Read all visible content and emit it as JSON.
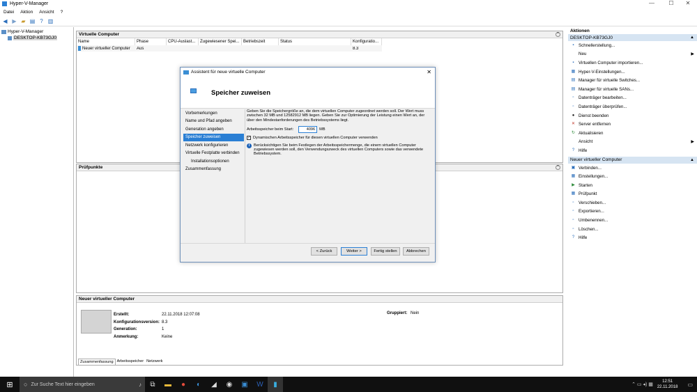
{
  "window": {
    "title": "Hyper-V-Manager",
    "minimize": "—",
    "maximize": "☐",
    "close": "✕"
  },
  "menu": [
    "Datei",
    "Aktion",
    "Ansicht",
    "?"
  ],
  "tree": {
    "root": "Hyper-V-Manager",
    "host": "DESKTOP-KB73GJ0"
  },
  "vms": {
    "title": "Virtuelle Computer",
    "columns": [
      "Name",
      "Phase",
      "CPU-Auslast...",
      "Zugewiesener Spei...",
      "Betriebszeit",
      "Status",
      "Konfiguratio..."
    ],
    "rows": [
      {
        "name": "Neuer virtueller Computer",
        "phase": "Aus",
        "cpu": "",
        "mem": "",
        "uptime": "",
        "status": "",
        "config": "8.3"
      }
    ]
  },
  "checkpoints": {
    "title": "Prüfpunkte"
  },
  "details": {
    "title": "Neuer virtueller Computer",
    "fields": [
      {
        "label": "Erstellt:",
        "value": "22.11.2018 12:07:08"
      },
      {
        "label": "Konfigurationsversion:",
        "value": "8.3"
      },
      {
        "label": "Generation:",
        "value": "1"
      },
      {
        "label": "Anmerkung:",
        "value": "Keine"
      }
    ],
    "grouped_label": "Gruppiert:",
    "grouped_value": "Nein",
    "tabs": [
      "Zusammenfassung",
      "Arbeitsspeicher",
      "Netzwerk"
    ]
  },
  "actions": {
    "title": "Aktionen",
    "host_header": "DESKTOP-KB73GJ0",
    "host_items": [
      {
        "label": "Schnellerstellung...",
        "icon": "quick-create-icon"
      },
      {
        "label": "Neu",
        "icon": "",
        "submenu": true
      },
      {
        "label": "Virtuellen Computer importieren...",
        "icon": "import-icon"
      },
      {
        "label": "Hyper-V-Einstellungen...",
        "icon": "settings-icon"
      },
      {
        "label": "Manager für virtuelle Switches...",
        "icon": "switch-icon"
      },
      {
        "label": "Manager für virtuelle SANs...",
        "icon": "san-icon"
      },
      {
        "label": "Datenträger bearbeiten...",
        "icon": "disk-edit-icon"
      },
      {
        "label": "Datenträger überprüfen...",
        "icon": "disk-check-icon"
      },
      {
        "label": "Dienst beenden",
        "icon": "stop-icon"
      },
      {
        "label": "Server entfernen",
        "icon": "remove-icon"
      },
      {
        "label": "Aktualisieren",
        "icon": "refresh-icon"
      },
      {
        "label": "Ansicht",
        "icon": "",
        "submenu": true
      },
      {
        "label": "Hilfe",
        "icon": "help-icon"
      }
    ],
    "vm_header": "Neuer virtueller Computer",
    "vm_items": [
      {
        "label": "Verbinden...",
        "icon": "connect-icon"
      },
      {
        "label": "Einstellungen...",
        "icon": "settings-icon"
      },
      {
        "label": "Starten",
        "icon": "start-icon"
      },
      {
        "label": "Prüfpunkt",
        "icon": "checkpoint-icon"
      },
      {
        "label": "Verschieben...",
        "icon": "move-icon"
      },
      {
        "label": "Exportieren...",
        "icon": "export-icon"
      },
      {
        "label": "Umbenennen...",
        "icon": "rename-icon"
      },
      {
        "label": "Löschen...",
        "icon": "delete-icon"
      },
      {
        "label": "Hilfe",
        "icon": "help-icon"
      }
    ]
  },
  "wizard": {
    "title": "Assistent für neue virtuelle Computer",
    "heading": "Speicher zuweisen",
    "steps": [
      {
        "label": "Vorbemerkungen"
      },
      {
        "label": "Name und Pfad angeben"
      },
      {
        "label": "Generation angeben"
      },
      {
        "label": "Speicher zuweisen",
        "selected": true
      },
      {
        "label": "Netzwerk konfigurieren"
      },
      {
        "label": "Virtuelle Festplatte verbinden"
      },
      {
        "label": "Installationsoptionen",
        "indent": true
      },
      {
        "label": "Zusammenfassung"
      }
    ],
    "description": "Geben Sie die Speichergröße an, die dem virtuellen Computer zugeordnet werden soll. Der Wert muss zwischen 32 MB und 12582912 MB liegen. Geben Sie zur Optimierung der Leistung einen Wert an, der über den Mindestanforderungen des Betriebssystems liegt.",
    "startup_label": "Arbeitsspeicher beim Start:",
    "startup_value": "4096",
    "unit": "MB",
    "dynamic_label": "Dynamischen Arbeitsspeicher für diesen virtuellen Computer verwenden",
    "dynamic_checked": true,
    "info": "Berücksichtigen Sie beim Festlegen der Arbeitsspeichermenge, die einem virtuellen Computer zugewiesen werden soll, den Verwendungszweck des virtuellen Computers sowie das verwendete Betriebssystem.",
    "buttons": {
      "back": "< Zurück",
      "next": "Weiter >",
      "finish": "Fertig stellen",
      "cancel": "Abbrechen"
    }
  },
  "taskbar": {
    "search_placeholder": "Zur Suche Text hier eingeben",
    "time": "12:51",
    "date": "22.11.2018"
  },
  "colors": {
    "accent": "#2a7fd4",
    "action_header": "#d6e4f2",
    "taskbar": "#101010"
  }
}
